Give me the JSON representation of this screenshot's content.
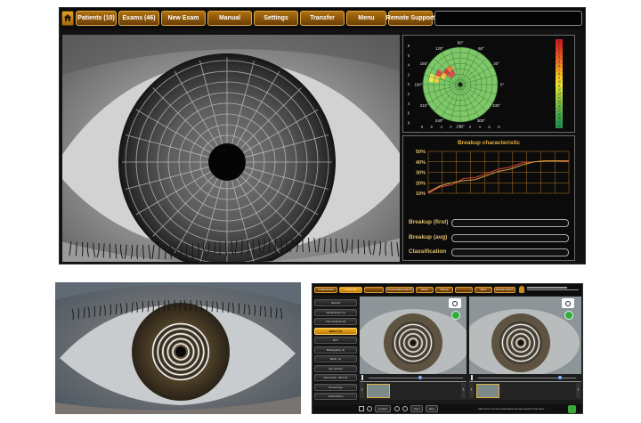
{
  "top_app": {
    "nav": [
      {
        "label": "Patients (10)"
      },
      {
        "label": "Exams (46)"
      },
      {
        "label": "New Exam"
      },
      {
        "label": "Manual"
      },
      {
        "label": "Settings"
      },
      {
        "label": "Transfer"
      },
      {
        "label": "Menu"
      },
      {
        "label": "Remote Support"
      }
    ],
    "icons": {
      "home": "home-icon"
    },
    "polar_map": {
      "angle_labels": [
        "90°",
        "60°",
        "30°",
        "0°",
        "330°",
        "300°",
        "270°",
        "240°",
        "210°",
        "180°",
        "150°",
        "120°"
      ],
      "axis_values": [
        "8",
        "6",
        "4",
        "2",
        "0",
        "2",
        "4",
        "6",
        "8"
      ],
      "scale_values": [
        "0",
        "1",
        "2",
        "3",
        "4",
        "5",
        "6",
        "7",
        "8",
        "9",
        "10",
        "11",
        "12",
        "13",
        "14",
        "15",
        "16",
        "17",
        "18",
        "19",
        "20",
        "21"
      ]
    },
    "breakup_chart": {
      "title": "Breakup characteristic",
      "y_ticks": [
        "50%",
        "40%",
        "30%",
        "20%",
        "10%"
      ],
      "chart_data": {
        "type": "line",
        "title": "Breakup characteristic",
        "ylim": [
          10,
          50
        ],
        "y_unit": "%",
        "series": [
          {
            "color": "#d04040",
            "values": [
              10,
              16,
              18,
              24,
              25,
              29,
              33,
              35,
              39,
              40,
              41,
              41,
              40
            ]
          },
          {
            "color": "#d8a040",
            "values": [
              11,
              17,
              20,
              22,
              23,
              27,
              31,
              33,
              37,
              40,
              41,
              41,
              41
            ]
          }
        ]
      }
    },
    "rows": [
      {
        "label": "Breakup (first)"
      },
      {
        "label": "Breakup (avg)"
      },
      {
        "label": "Classification"
      }
    ],
    "colors": {
      "accent": "#b0710d",
      "panel": "#0b0b0b",
      "grid_green": "#7ec86a"
    }
  },
  "bottom_app": {
    "tabs": [
      "Contact lenses",
      "Screen (5)",
      "",
      "Documentation Help (5)",
      "History",
      "Settings",
      "",
      "Menu",
      "Remote Support"
    ],
    "sidebar": [
      "Network",
      "Interferometry (1)",
      "Tear meniscus (2)",
      "NIKBUT (2)",
      "BUT",
      "Meibography (1)",
      "Bleph. (1)",
      "Eye redness",
      "Fluorescein - BUT (1)",
      "Pre-lens Eye",
      "Patient Exam"
    ],
    "active_sidebar_index": 3,
    "footer_buttons": [
      "Contact",
      "Open",
      "Save"
    ],
    "status_text": "Click here to do the examination and get result for this video"
  }
}
